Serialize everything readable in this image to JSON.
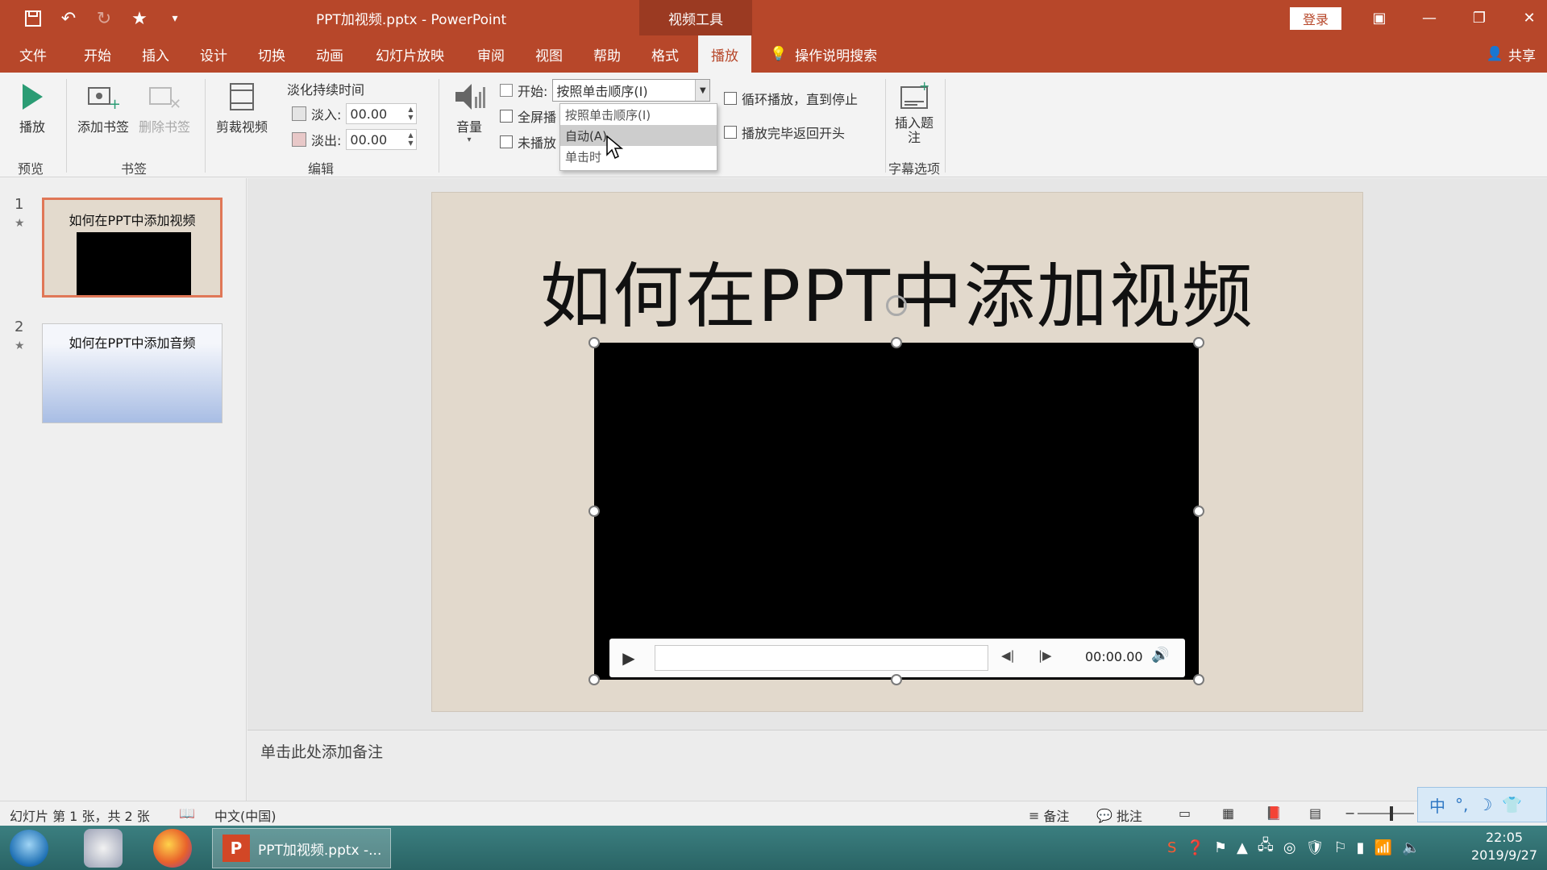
{
  "titlebar": {
    "doc_title": "PPT加视频.pptx  -  PowerPoint",
    "context_tool": "视频工具",
    "login": "登录"
  },
  "tabs": [
    {
      "label": "文件"
    },
    {
      "label": "开始"
    },
    {
      "label": "插入"
    },
    {
      "label": "设计"
    },
    {
      "label": "切换"
    },
    {
      "label": "动画"
    },
    {
      "label": "幻灯片放映"
    },
    {
      "label": "审阅"
    },
    {
      "label": "视图"
    },
    {
      "label": "帮助"
    },
    {
      "label": "格式"
    },
    {
      "label": "播放"
    }
  ],
  "tell_me": "操作说明搜索",
  "share": "共享",
  "ribbon": {
    "preview": {
      "play": "播放",
      "group": "预览"
    },
    "bookmarks": {
      "add": "添加书签",
      "remove": "删除书签",
      "group": "书签"
    },
    "editing": {
      "trim": "剪裁视频",
      "fade_title": "淡化持续时间",
      "fade_in_label": "淡入:",
      "fade_in_value": "00.00",
      "fade_out_label": "淡出:",
      "fade_out_value": "00.00",
      "group": "编辑"
    },
    "video_options": {
      "volume": "音量",
      "start_label": "开始:",
      "start_value": "按照单击顺序(I)",
      "fullscreen": "全屏播",
      "hide_not_playing": "未播放",
      "loop": "循环播放，直到停止",
      "rewind": "播放完毕返回开头"
    },
    "captions": {
      "insert": "插入题",
      "insert_line2": "注",
      "group": "字幕选项"
    }
  },
  "start_menu": {
    "items": [
      "按照单击顺序(I)",
      "自动(A)",
      "单击时"
    ],
    "highlighted_index": 1
  },
  "slides": [
    {
      "num": "1",
      "title": "如何在PPT中添加视频",
      "selected": true
    },
    {
      "num": "2",
      "title": "如何在PPT中添加音频",
      "selected": false
    }
  ],
  "slide": {
    "title": "如何在PPT中添加视频",
    "video_time": "00:00.00"
  },
  "notes_placeholder": "单击此处添加备注",
  "status": {
    "slide_info": "幻灯片 第 1 张，共 2 张",
    "language": "中文(中国)",
    "notes": "备注",
    "comments": "批注"
  },
  "ime": "中",
  "taskbar": {
    "ppt_label": "PPT加视频.pptx -...",
    "time": "22:05",
    "date": "2019/9/27"
  },
  "colors": {
    "accent": "#b7472a",
    "slide_bg": "#e2d9cc",
    "thumb_selected": "#e07757"
  }
}
